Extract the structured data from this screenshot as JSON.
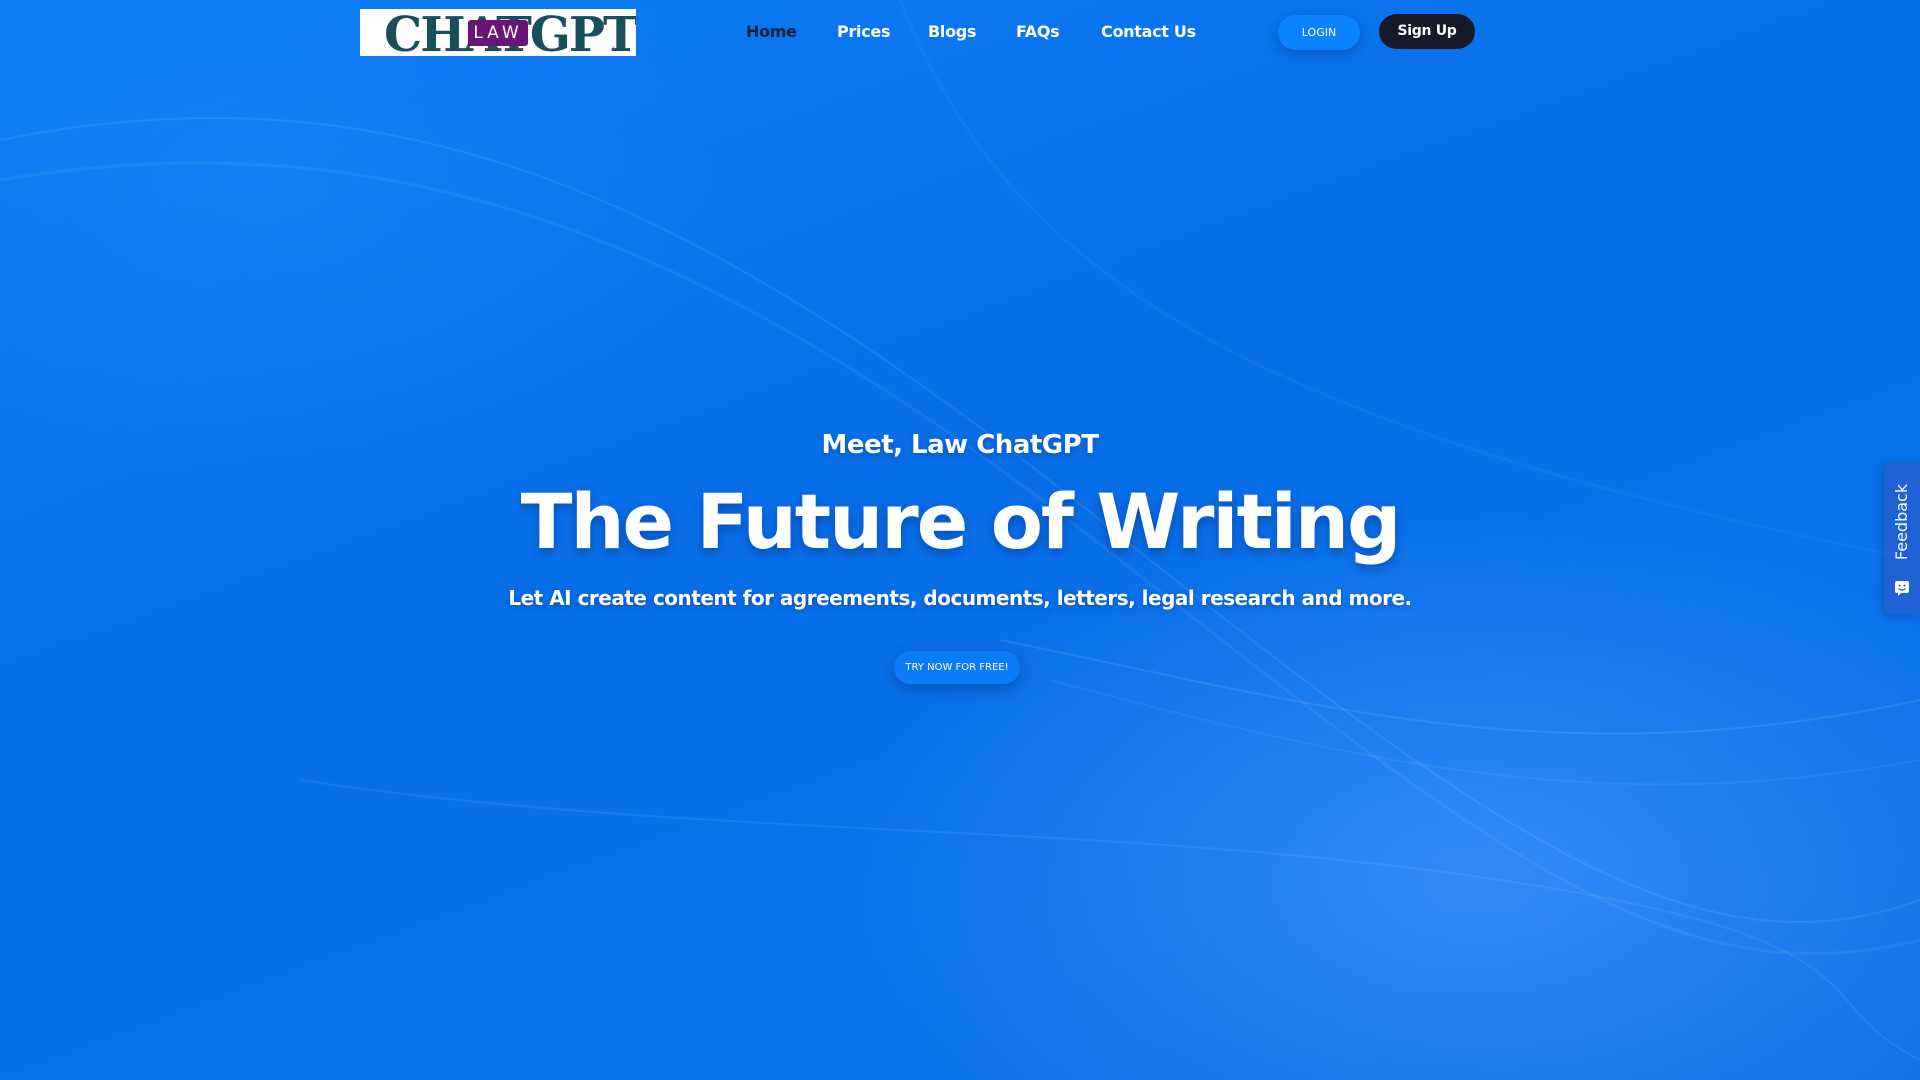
{
  "logo": {
    "wordmark": "CHATGPT",
    "badge": "LAW"
  },
  "nav": {
    "items": [
      {
        "label": "Home",
        "active": true
      },
      {
        "label": "Prices",
        "active": false
      },
      {
        "label": "Blogs",
        "active": false
      },
      {
        "label": "FAQs",
        "active": false
      },
      {
        "label": "Contact Us",
        "active": false
      }
    ]
  },
  "auth": {
    "login_label": "LOGIN",
    "signup_label": "Sign Up"
  },
  "hero": {
    "eyebrow": "Meet, Law ChatGPT",
    "title": "The Future of Writing",
    "description": "Let AI create content for agreements, documents, letters, legal research and more.",
    "cta_label": "TRY NOW FOR FREE!"
  },
  "feedback": {
    "label": "Feedback",
    "icon": "smile-chat-icon"
  },
  "colors": {
    "background": "#0a73ee",
    "nav_active": "#0e2136",
    "signup_bg": "#17192b",
    "logo_text": "#17505c",
    "logo_badge": "#6a1476",
    "feedback_tab": "#1e62d6"
  }
}
